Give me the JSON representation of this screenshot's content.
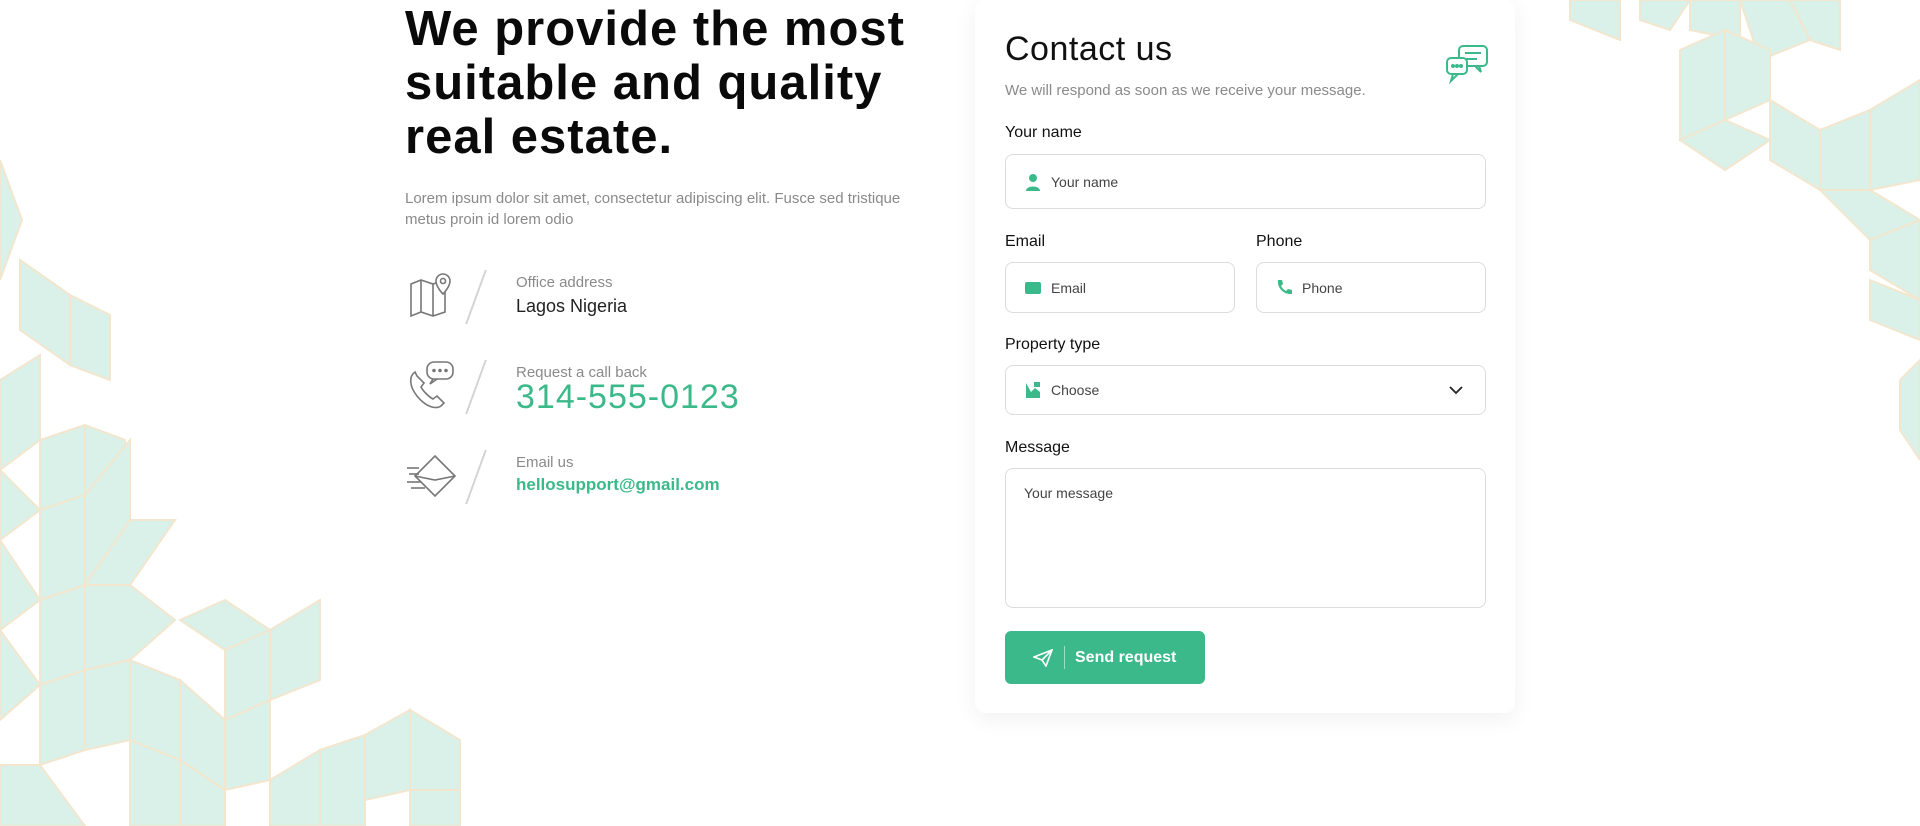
{
  "hero": {
    "title_line1": "We provide the most",
    "title_line2": "suitable and quality",
    "title_line3": "real estate.",
    "lead": "Lorem ipsum dolor sit amet, consectetur adipiscing elit. Fusce sed tristique metus proin id lorem odio"
  },
  "info": {
    "office": {
      "label": "Office address",
      "value": "Lagos Nigeria",
      "icon": "map-pin-icon"
    },
    "call": {
      "label": "Request a call back",
      "value": "314-555-0123",
      "icon": "phone-chat-icon"
    },
    "email": {
      "label": "Email us",
      "value": "hellosupport@gmail.com",
      "icon": "envelope-fast-icon"
    }
  },
  "form": {
    "title": "Contact us",
    "subtitle": "We will respond as soon as we receive your message.",
    "name": {
      "label": "Your name",
      "placeholder": "Your name"
    },
    "email": {
      "label": "Email",
      "placeholder": "Email"
    },
    "phone": {
      "label": "Phone",
      "placeholder": "Phone"
    },
    "property": {
      "label": "Property type",
      "selected": "Choose"
    },
    "message": {
      "label": "Message",
      "placeholder": "Your message"
    },
    "submit_label": "Send request"
  },
  "colors": {
    "accent": "#3cb98a",
    "pattern_fill": "#d9f1e8",
    "pattern_stroke": "#f3e6cf",
    "muted_text": "#8a8a8a"
  }
}
